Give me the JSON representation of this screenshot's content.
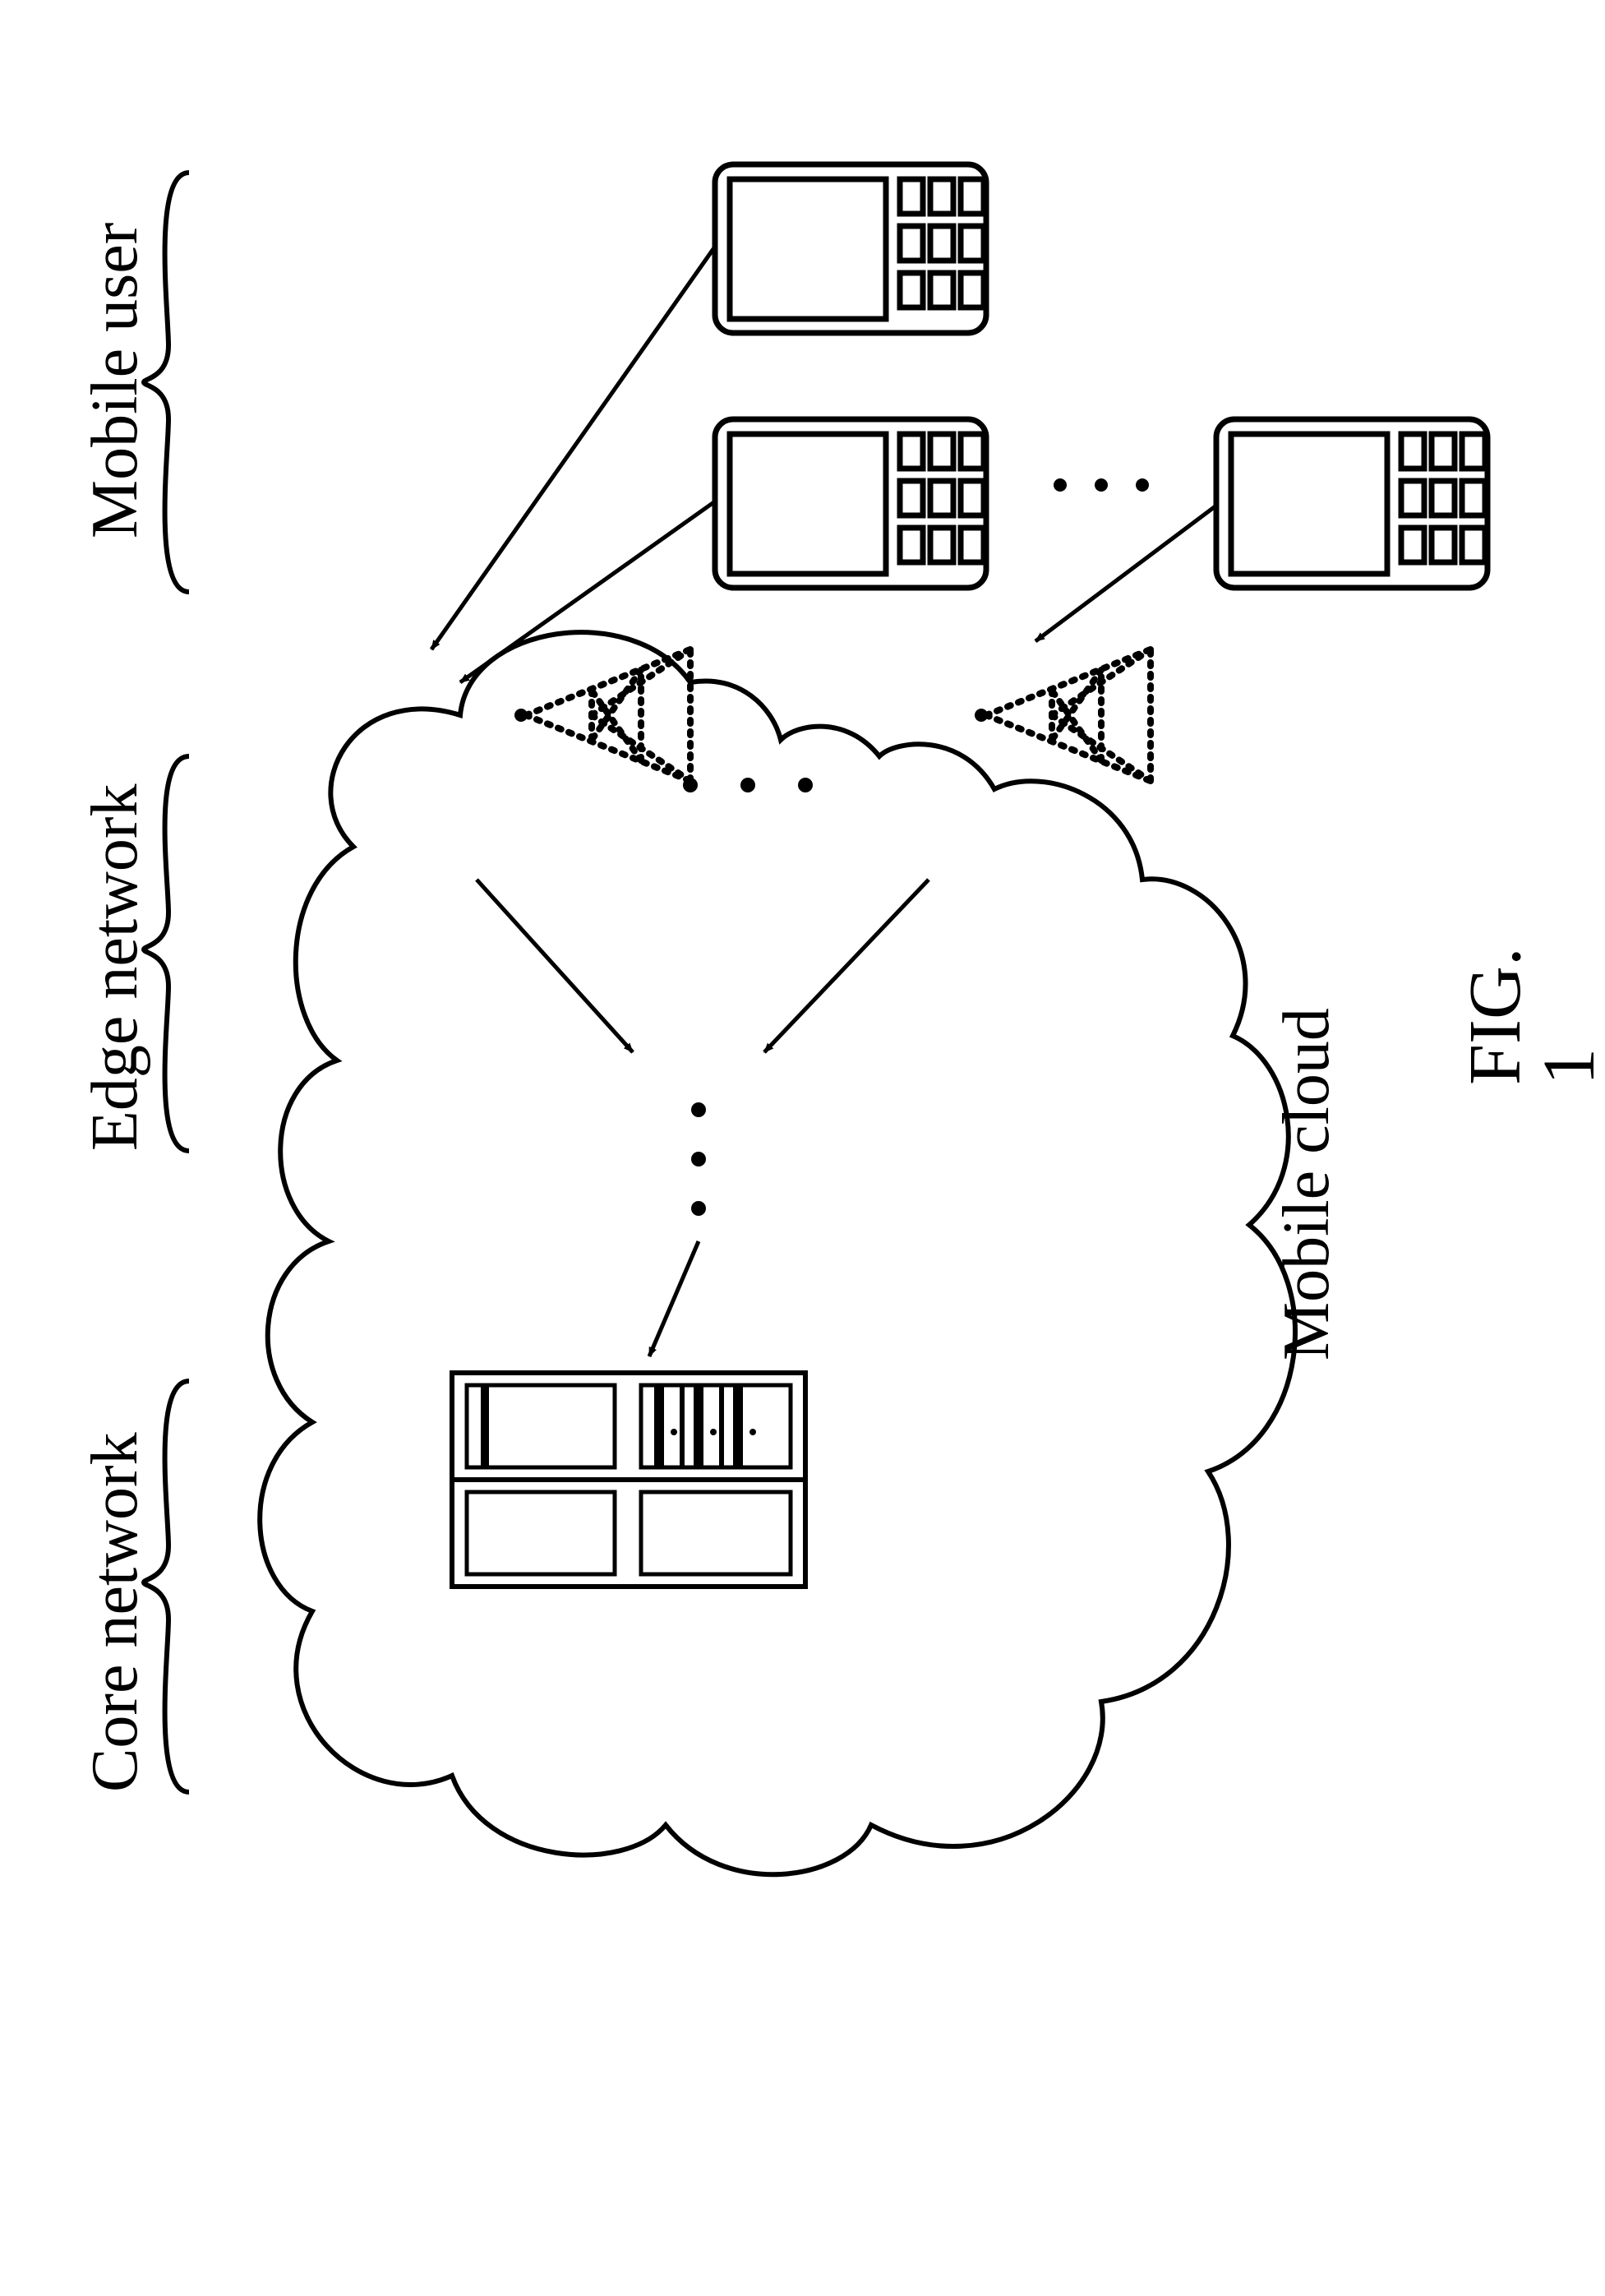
{
  "labels": {
    "mobile_user": "Mobile user",
    "edge_network": "Edge network",
    "core_network": "Core network",
    "mobile_cloud": "Mobile cloud",
    "figure": "FIG. 1"
  }
}
